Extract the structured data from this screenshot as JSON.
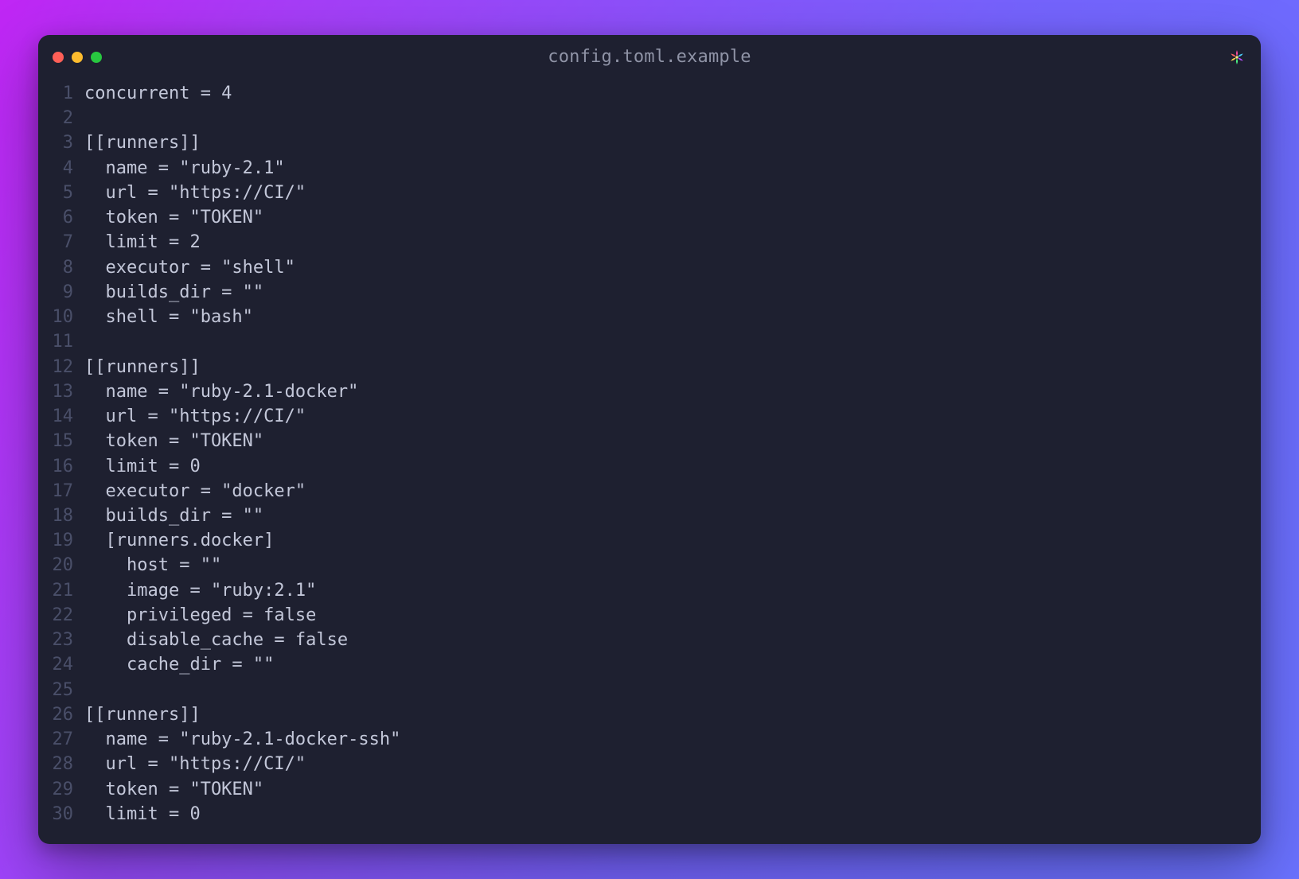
{
  "window": {
    "title": "config.toml.example",
    "traffic_close_color": "#ff5f57",
    "traffic_min_color": "#febc2e",
    "traffic_max_color": "#28c840"
  },
  "code_lines": [
    "concurrent = 4",
    "",
    "[[runners]]",
    "  name = \"ruby-2.1\"",
    "  url = \"https://CI/\"",
    "  token = \"TOKEN\"",
    "  limit = 2",
    "  executor = \"shell\"",
    "  builds_dir = \"\"",
    "  shell = \"bash\"",
    "",
    "[[runners]]",
    "  name = \"ruby-2.1-docker\"",
    "  url = \"https://CI/\"",
    "  token = \"TOKEN\"",
    "  limit = 0",
    "  executor = \"docker\"",
    "  builds_dir = \"\"",
    "  [runners.docker]",
    "    host = \"\"",
    "    image = \"ruby:2.1\"",
    "    privileged = false",
    "    disable_cache = false",
    "    cache_dir = \"\"",
    "",
    "[[runners]]",
    "  name = \"ruby-2.1-docker-ssh\"",
    "  url = \"https://CI/\"",
    "  token = \"TOKEN\"",
    "  limit = 0"
  ]
}
